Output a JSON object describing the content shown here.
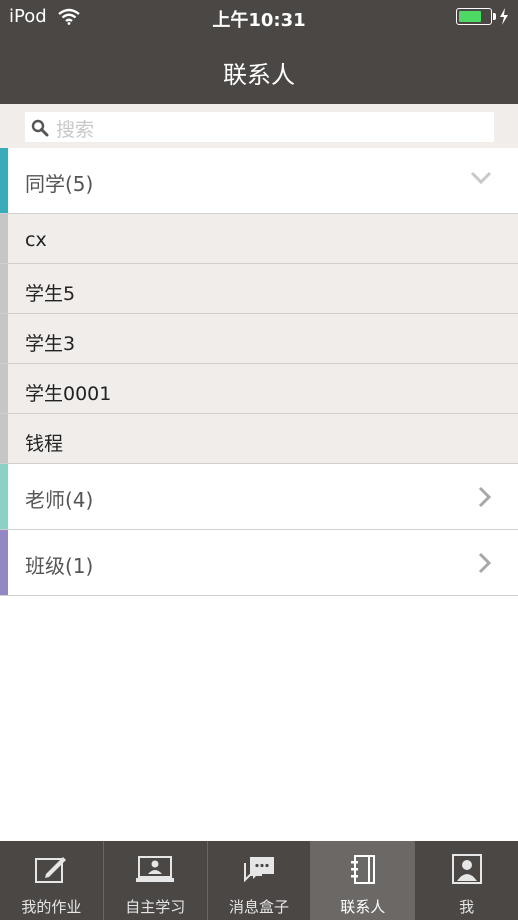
{
  "status_bar": {
    "carrier": "iPod",
    "time": "上午10:31",
    "battery_level": 0.75
  },
  "nav": {
    "title": "联系人"
  },
  "search": {
    "placeholder": "搜索"
  },
  "groups": [
    {
      "label": "同学(5)",
      "expanded": true,
      "accent": "#3aacb9",
      "members": [
        "cx",
        "学生5",
        "学生3",
        "学生0001",
        "钱程"
      ]
    },
    {
      "label": "老师(4)",
      "expanded": false,
      "accent": "#8dd1c6"
    },
    {
      "label": "班级(1)",
      "expanded": false,
      "accent": "#9488c4"
    }
  ],
  "tabs": [
    {
      "label": "我的作业",
      "icon": "homework-pencil-icon",
      "active": false
    },
    {
      "label": "自主学习",
      "icon": "self-study-screen-icon",
      "active": false
    },
    {
      "label": "消息盒子",
      "icon": "message-bubbles-icon",
      "active": false
    },
    {
      "label": "联系人",
      "icon": "contacts-notebook-icon",
      "active": true
    },
    {
      "label": "我",
      "icon": "profile-person-icon",
      "active": false
    }
  ]
}
